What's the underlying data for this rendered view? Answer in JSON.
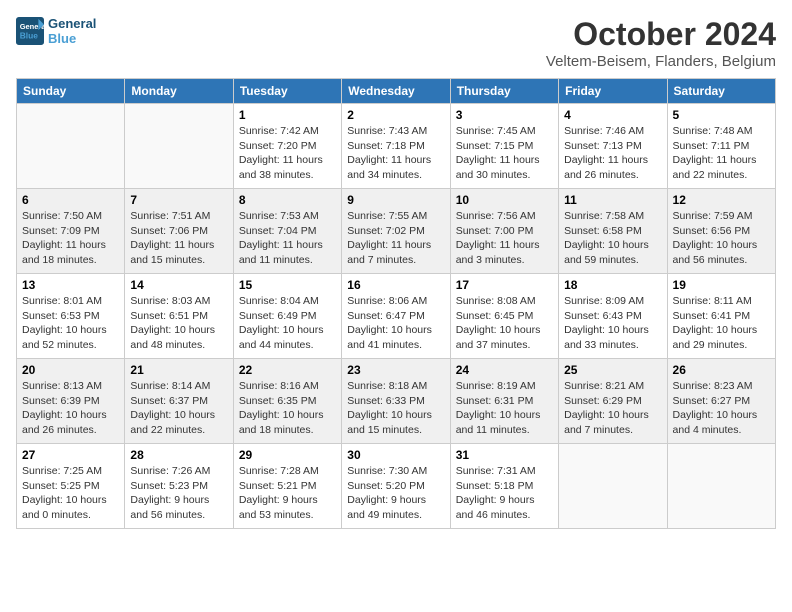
{
  "header": {
    "logo_line1": "General",
    "logo_line2": "Blue",
    "month": "October 2024",
    "location": "Veltem-Beisem, Flanders, Belgium"
  },
  "weekdays": [
    "Sunday",
    "Monday",
    "Tuesday",
    "Wednesday",
    "Thursday",
    "Friday",
    "Saturday"
  ],
  "weeks": [
    [
      {
        "day": "",
        "sunrise": "",
        "sunset": "",
        "daylight": ""
      },
      {
        "day": "",
        "sunrise": "",
        "sunset": "",
        "daylight": ""
      },
      {
        "day": "1",
        "sunrise": "Sunrise: 7:42 AM",
        "sunset": "Sunset: 7:20 PM",
        "daylight": "Daylight: 11 hours and 38 minutes."
      },
      {
        "day": "2",
        "sunrise": "Sunrise: 7:43 AM",
        "sunset": "Sunset: 7:18 PM",
        "daylight": "Daylight: 11 hours and 34 minutes."
      },
      {
        "day": "3",
        "sunrise": "Sunrise: 7:45 AM",
        "sunset": "Sunset: 7:15 PM",
        "daylight": "Daylight: 11 hours and 30 minutes."
      },
      {
        "day": "4",
        "sunrise": "Sunrise: 7:46 AM",
        "sunset": "Sunset: 7:13 PM",
        "daylight": "Daylight: 11 hours and 26 minutes."
      },
      {
        "day": "5",
        "sunrise": "Sunrise: 7:48 AM",
        "sunset": "Sunset: 7:11 PM",
        "daylight": "Daylight: 11 hours and 22 minutes."
      }
    ],
    [
      {
        "day": "6",
        "sunrise": "Sunrise: 7:50 AM",
        "sunset": "Sunset: 7:09 PM",
        "daylight": "Daylight: 11 hours and 18 minutes."
      },
      {
        "day": "7",
        "sunrise": "Sunrise: 7:51 AM",
        "sunset": "Sunset: 7:06 PM",
        "daylight": "Daylight: 11 hours and 15 minutes."
      },
      {
        "day": "8",
        "sunrise": "Sunrise: 7:53 AM",
        "sunset": "Sunset: 7:04 PM",
        "daylight": "Daylight: 11 hours and 11 minutes."
      },
      {
        "day": "9",
        "sunrise": "Sunrise: 7:55 AM",
        "sunset": "Sunset: 7:02 PM",
        "daylight": "Daylight: 11 hours and 7 minutes."
      },
      {
        "day": "10",
        "sunrise": "Sunrise: 7:56 AM",
        "sunset": "Sunset: 7:00 PM",
        "daylight": "Daylight: 11 hours and 3 minutes."
      },
      {
        "day": "11",
        "sunrise": "Sunrise: 7:58 AM",
        "sunset": "Sunset: 6:58 PM",
        "daylight": "Daylight: 10 hours and 59 minutes."
      },
      {
        "day": "12",
        "sunrise": "Sunrise: 7:59 AM",
        "sunset": "Sunset: 6:56 PM",
        "daylight": "Daylight: 10 hours and 56 minutes."
      }
    ],
    [
      {
        "day": "13",
        "sunrise": "Sunrise: 8:01 AM",
        "sunset": "Sunset: 6:53 PM",
        "daylight": "Daylight: 10 hours and 52 minutes."
      },
      {
        "day": "14",
        "sunrise": "Sunrise: 8:03 AM",
        "sunset": "Sunset: 6:51 PM",
        "daylight": "Daylight: 10 hours and 48 minutes."
      },
      {
        "day": "15",
        "sunrise": "Sunrise: 8:04 AM",
        "sunset": "Sunset: 6:49 PM",
        "daylight": "Daylight: 10 hours and 44 minutes."
      },
      {
        "day": "16",
        "sunrise": "Sunrise: 8:06 AM",
        "sunset": "Sunset: 6:47 PM",
        "daylight": "Daylight: 10 hours and 41 minutes."
      },
      {
        "day": "17",
        "sunrise": "Sunrise: 8:08 AM",
        "sunset": "Sunset: 6:45 PM",
        "daylight": "Daylight: 10 hours and 37 minutes."
      },
      {
        "day": "18",
        "sunrise": "Sunrise: 8:09 AM",
        "sunset": "Sunset: 6:43 PM",
        "daylight": "Daylight: 10 hours and 33 minutes."
      },
      {
        "day": "19",
        "sunrise": "Sunrise: 8:11 AM",
        "sunset": "Sunset: 6:41 PM",
        "daylight": "Daylight: 10 hours and 29 minutes."
      }
    ],
    [
      {
        "day": "20",
        "sunrise": "Sunrise: 8:13 AM",
        "sunset": "Sunset: 6:39 PM",
        "daylight": "Daylight: 10 hours and 26 minutes."
      },
      {
        "day": "21",
        "sunrise": "Sunrise: 8:14 AM",
        "sunset": "Sunset: 6:37 PM",
        "daylight": "Daylight: 10 hours and 22 minutes."
      },
      {
        "day": "22",
        "sunrise": "Sunrise: 8:16 AM",
        "sunset": "Sunset: 6:35 PM",
        "daylight": "Daylight: 10 hours and 18 minutes."
      },
      {
        "day": "23",
        "sunrise": "Sunrise: 8:18 AM",
        "sunset": "Sunset: 6:33 PM",
        "daylight": "Daylight: 10 hours and 15 minutes."
      },
      {
        "day": "24",
        "sunrise": "Sunrise: 8:19 AM",
        "sunset": "Sunset: 6:31 PM",
        "daylight": "Daylight: 10 hours and 11 minutes."
      },
      {
        "day": "25",
        "sunrise": "Sunrise: 8:21 AM",
        "sunset": "Sunset: 6:29 PM",
        "daylight": "Daylight: 10 hours and 7 minutes."
      },
      {
        "day": "26",
        "sunrise": "Sunrise: 8:23 AM",
        "sunset": "Sunset: 6:27 PM",
        "daylight": "Daylight: 10 hours and 4 minutes."
      }
    ],
    [
      {
        "day": "27",
        "sunrise": "Sunrise: 7:25 AM",
        "sunset": "Sunset: 5:25 PM",
        "daylight": "Daylight: 10 hours and 0 minutes."
      },
      {
        "day": "28",
        "sunrise": "Sunrise: 7:26 AM",
        "sunset": "Sunset: 5:23 PM",
        "daylight": "Daylight: 9 hours and 56 minutes."
      },
      {
        "day": "29",
        "sunrise": "Sunrise: 7:28 AM",
        "sunset": "Sunset: 5:21 PM",
        "daylight": "Daylight: 9 hours and 53 minutes."
      },
      {
        "day": "30",
        "sunrise": "Sunrise: 7:30 AM",
        "sunset": "Sunset: 5:20 PM",
        "daylight": "Daylight: 9 hours and 49 minutes."
      },
      {
        "day": "31",
        "sunrise": "Sunrise: 7:31 AM",
        "sunset": "Sunset: 5:18 PM",
        "daylight": "Daylight: 9 hours and 46 minutes."
      },
      {
        "day": "",
        "sunrise": "",
        "sunset": "",
        "daylight": ""
      },
      {
        "day": "",
        "sunrise": "",
        "sunset": "",
        "daylight": ""
      }
    ]
  ]
}
